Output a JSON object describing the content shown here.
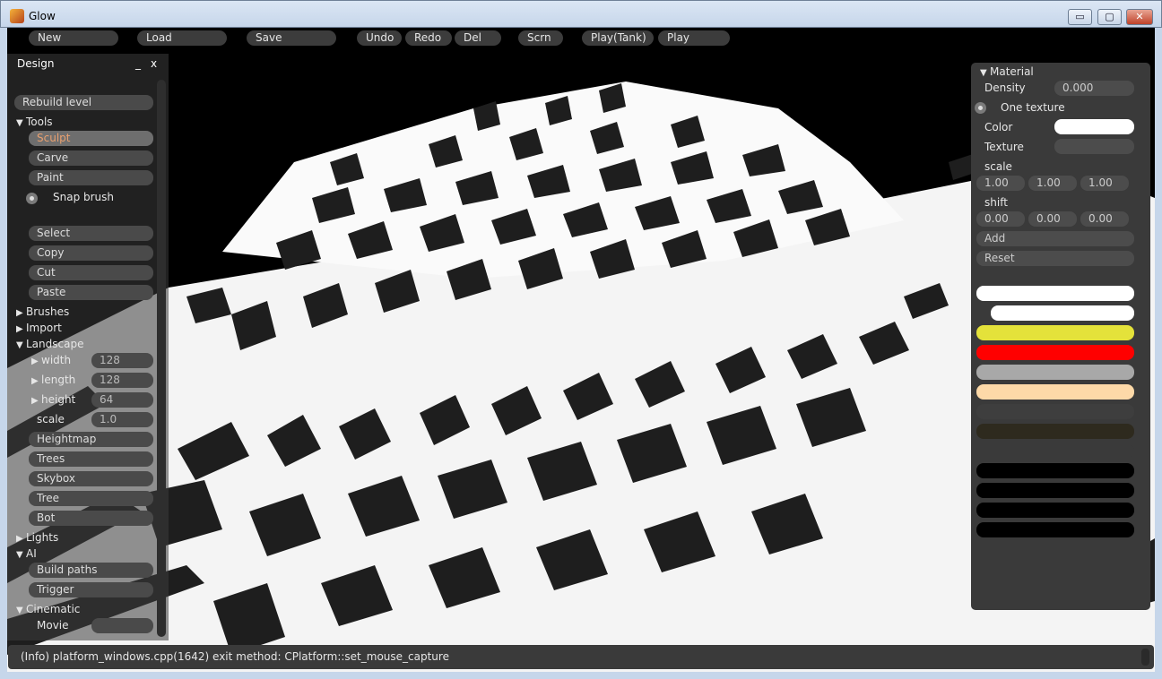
{
  "window": {
    "title": "Glow",
    "min": "▭",
    "max": "▢",
    "close": "✕",
    "icon": "app-icon"
  },
  "toolbar": {
    "new": "New",
    "load": "Load",
    "save": "Save",
    "undo": "Undo",
    "redo": "Redo",
    "del": "Del",
    "scrn": "Scrn",
    "play_tank": "Play(Tank)",
    "play": "Play"
  },
  "left_panel": {
    "title": "Design",
    "minimize": "_",
    "close": "x",
    "rebuild": "Rebuild level",
    "tools": {
      "label": "Tools",
      "sculpt": "Sculpt",
      "carve": "Carve",
      "paint": "Paint",
      "snap_brush": "Snap brush"
    },
    "edit": {
      "select": "Select",
      "copy": "Copy",
      "cut": "Cut",
      "paste": "Paste"
    },
    "brushes": "Brushes",
    "import": "Import",
    "landscape": {
      "label": "Landscape",
      "width_label": "width",
      "width_value": "128",
      "length_label": "length",
      "length_value": "128",
      "height_label": "height",
      "height_value": "64",
      "scale_label": "scale",
      "scale_value": "1.0",
      "heightmap": "Heightmap",
      "trees": "Trees",
      "skybox": "Skybox",
      "tree": "Tree",
      "bot": "Bot"
    },
    "lights": "Lights",
    "ai": {
      "label": "AI",
      "build_paths": "Build paths",
      "trigger": "Trigger"
    },
    "cinematic": {
      "label": "Cinematic",
      "movie": "Movie"
    }
  },
  "right_panel": {
    "material": "Material",
    "density_label": "Density",
    "density_value": "0.000",
    "one_texture": "One texture",
    "color_label": "Color",
    "texture_label": "Texture",
    "scale_label": "scale",
    "scale_values": [
      "1.00",
      "1.00",
      "1.00"
    ],
    "shift_label": "shift",
    "shift_values": [
      "0.00",
      "0.00",
      "0.00"
    ],
    "add": "Add",
    "reset": "Reset",
    "color_value": "#ffffff",
    "swatches": [
      "#ffffff",
      "#ffffff",
      "#e4e23a",
      "#ff0000",
      "#a8a8a8",
      "#fdd9a8",
      "#3e3e3e",
      "#2e2a1e",
      "#3a3a3a",
      "#000000",
      "#000000",
      "#000000",
      "#000000"
    ]
  },
  "status": {
    "message": "(Info) platform_windows.cpp(1642) exit method: CPlatform::set_mouse_capture"
  }
}
